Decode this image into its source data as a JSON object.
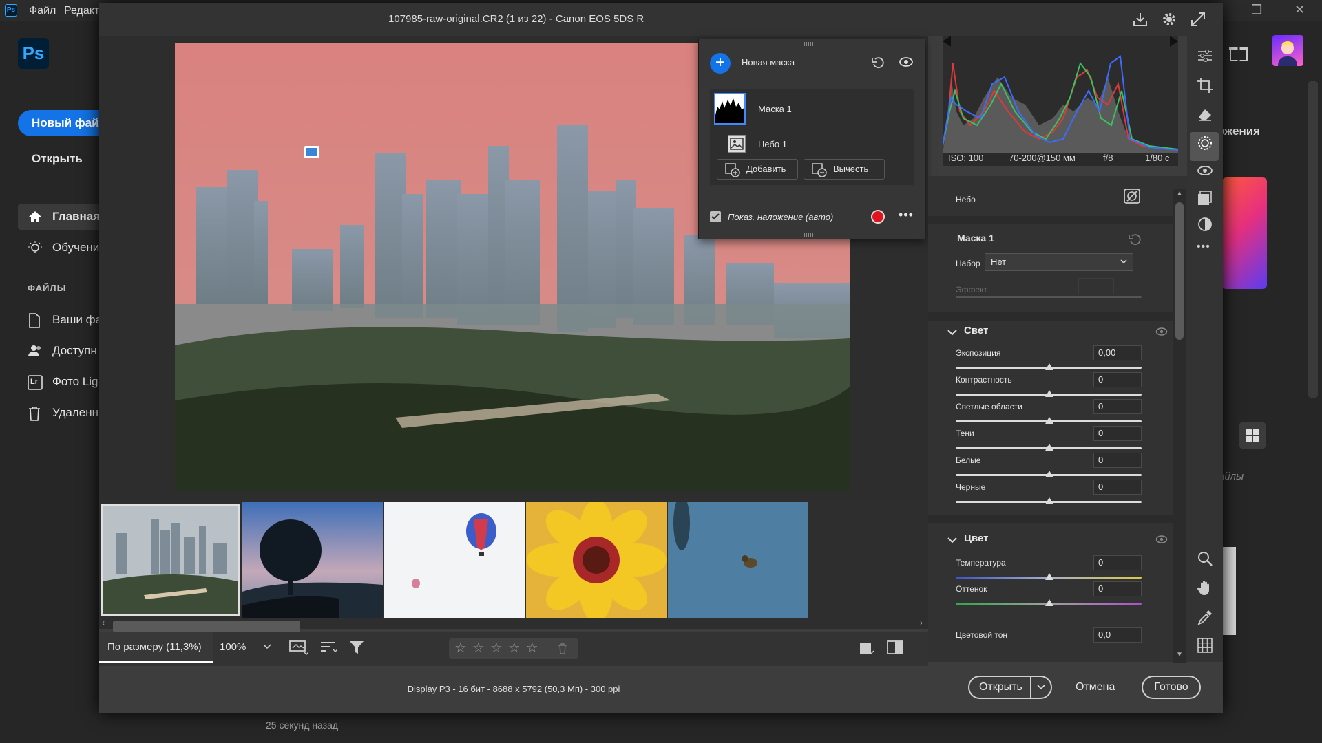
{
  "ps": {
    "logo": "Ps",
    "menu": [
      "Файл",
      "Редакти"
    ],
    "new_file": "Новый файл",
    "open": "Открыть",
    "nav": [
      "Главная",
      "Обучени",
      "Ваши фа",
      "Доступн",
      "Фото Lig",
      "Удаленн"
    ],
    "files_heading": "ФАЙЛЫ",
    "lr_badge": "Lr",
    "right_heading": "ожения",
    "right_files": "айлы",
    "time_ago": "25 секунд назад"
  },
  "dialog": {
    "title": "107985-raw-original.CR2 (1 из 22)  -  Canon EOS 5DS R"
  },
  "mask_panel": {
    "new_mask": "Новая маска",
    "mask1": "Маска 1",
    "sky1": "Небо 1",
    "add": "Добавить",
    "subtract": "Вычесть",
    "overlay": "Показ. наложение (авто)",
    "overlay_checked": true,
    "overlay_color": "#e0141c"
  },
  "histogram": {
    "iso": "ISO: 100",
    "lens": "70-200@150 мм",
    "aperture": "f/8",
    "shutter": "1/80 с"
  },
  "panel": {
    "sky_label": "Небо",
    "mask_title": "Маска 1",
    "preset_label": "Набор",
    "preset_value": "Нет",
    "effect_label": "Эффект",
    "light": {
      "title": "Свет",
      "rows": [
        {
          "label": "Экспозиция",
          "value": "0,00"
        },
        {
          "label": "Контрастность",
          "value": "0"
        },
        {
          "label": "Светлые области",
          "value": "0"
        },
        {
          "label": "Тени",
          "value": "0"
        },
        {
          "label": "Белые",
          "value": "0"
        },
        {
          "label": "Черные",
          "value": "0"
        }
      ]
    },
    "color": {
      "title": "Цвет",
      "rows": [
        {
          "label": "Температура",
          "value": "0"
        },
        {
          "label": "Оттенок",
          "value": "0"
        },
        {
          "label": "Цветовой тон",
          "value": "0,0"
        }
      ]
    }
  },
  "bottom": {
    "fit": "По размеру (11,3%)",
    "zoom": "100%",
    "stars": "☆☆☆☆☆",
    "status": "Display P3 - 16 бит - 8688 x 5792 (50,3 Мп) - 300 ppi",
    "open_btn": "Открыть",
    "cancel_btn": "Отмена",
    "done_btn": "Готово"
  }
}
